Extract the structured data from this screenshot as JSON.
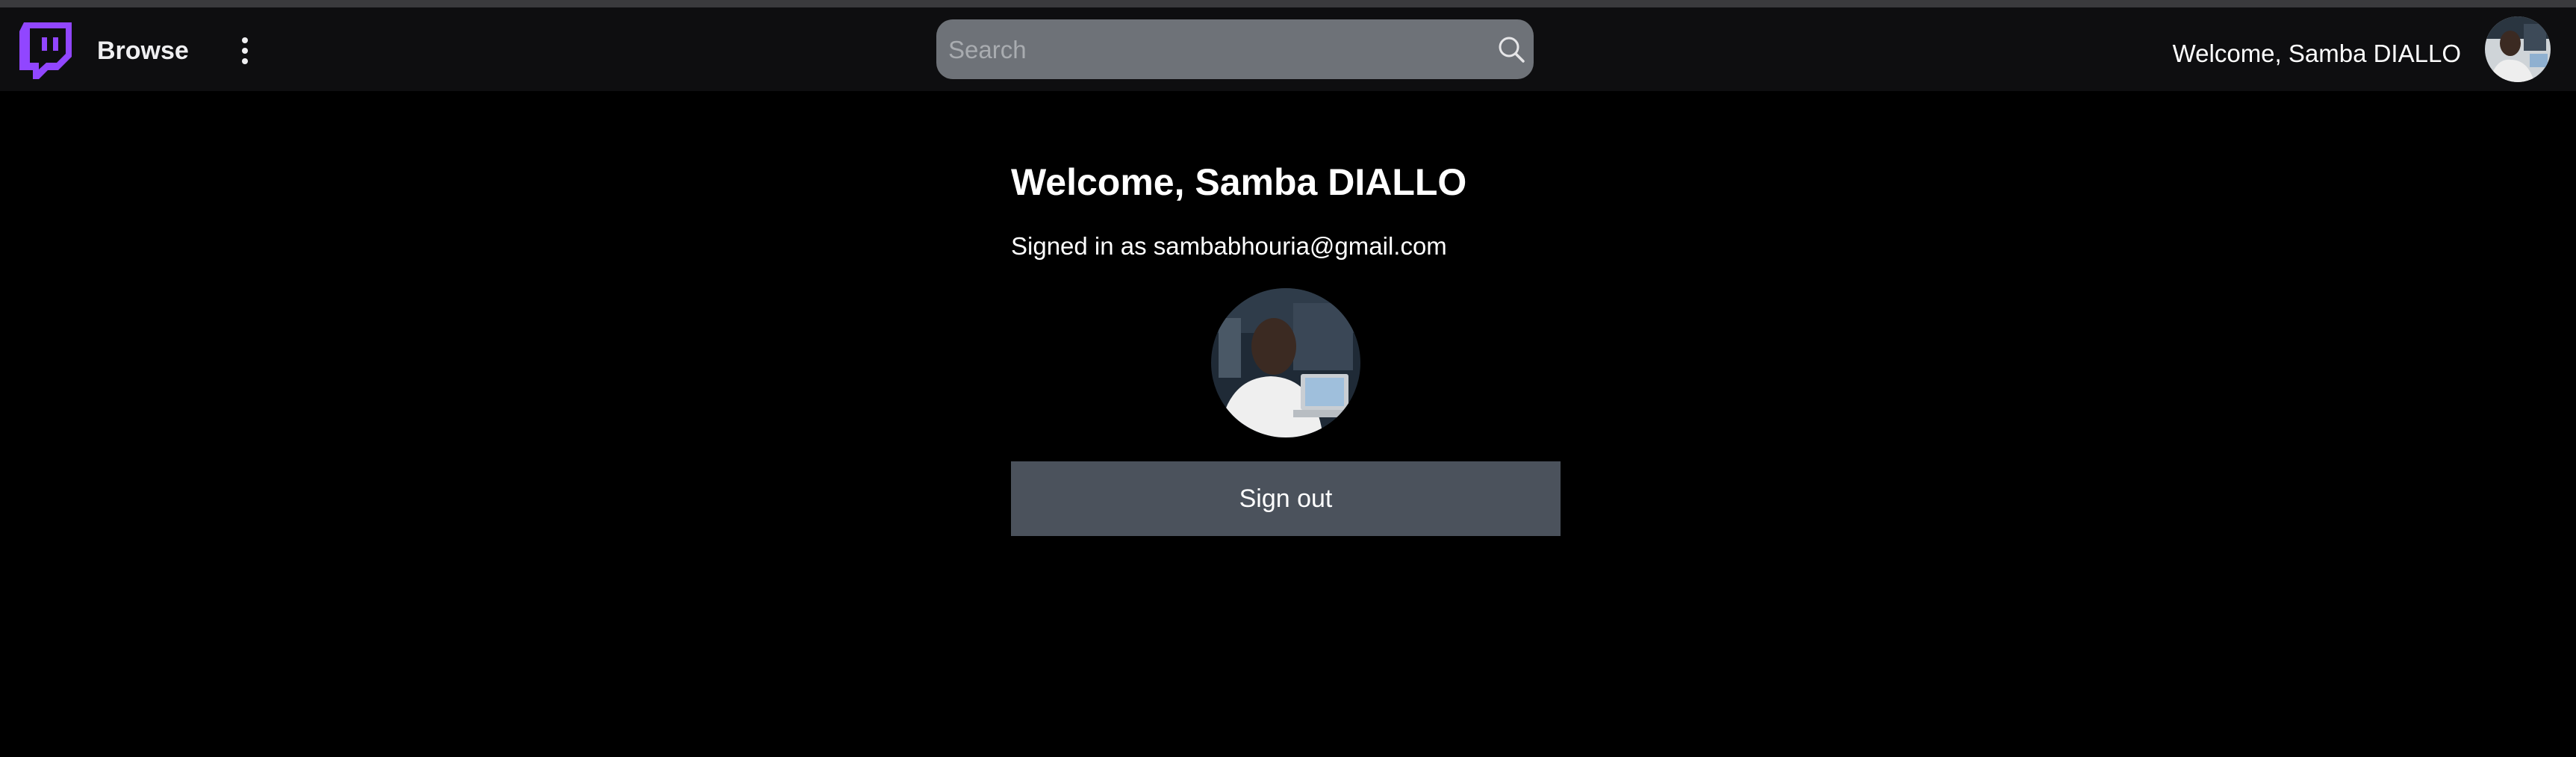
{
  "navbar": {
    "logo_icon": "twitch-logo-icon",
    "browse_label": "Browse",
    "more_icon": "vertical-dots-icon",
    "search": {
      "placeholder": "Search",
      "value": "",
      "icon": "search-icon"
    },
    "welcome_text": "Welcome, Samba DIALLO",
    "avatar_icon": "user-avatar"
  },
  "main": {
    "title": "Welcome, Samba DIALLO",
    "signed_in_text": "Signed in as sambabhouria@gmail.com",
    "avatar_icon": "user-avatar",
    "signout_label": "Sign out"
  },
  "colors": {
    "background": "#000000",
    "navbar": "#0e0e10",
    "brand_purple": "#9146ff",
    "search_bg": "#6e7278",
    "button_bg": "#4b525c"
  }
}
